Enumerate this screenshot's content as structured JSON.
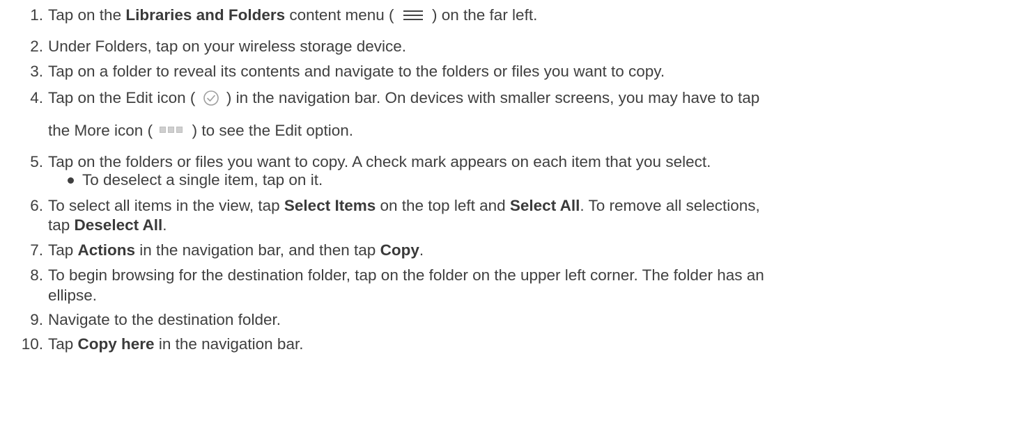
{
  "steps": [
    {
      "number": "1.",
      "parts": [
        "Tap on the ",
        "Libraries and Folders",
        " content menu ( ",
        " ) on the far left."
      ],
      "icon": "hamburger-menu-icon"
    },
    {
      "number": "2.",
      "text": "Under Folders, tap on your wireless storage device."
    },
    {
      "number": "3.",
      "text": "Tap on a folder to reveal its contents and navigate to the folders or files you want to copy."
    },
    {
      "number": "4.",
      "line1_parts": [
        "Tap on the Edit icon ( ",
        " ) in the navigation bar. On devices with smaller screens, you may have to tap"
      ],
      "line2_parts": [
        "the More icon ( ",
        " ) to see the Edit option."
      ],
      "icons": [
        "edit-checkmark-icon",
        "more-dots-icon"
      ]
    },
    {
      "number": "5.",
      "text": "Tap on the folders or files you want to copy. A check mark appears on each item that you select.",
      "bullet": "To deselect a single item, tap on it."
    },
    {
      "number": "6.",
      "line1_parts": [
        "To select all items in the view, tap ",
        "Select Items",
        " on the top left and ",
        "Select All",
        ". To remove all selections,"
      ],
      "line2_parts": [
        "tap ",
        "Deselect All",
        "."
      ]
    },
    {
      "number": "7.",
      "parts": [
        "Tap ",
        "Actions",
        " in the navigation bar, and then tap ",
        "Copy",
        "."
      ]
    },
    {
      "number": "8.",
      "line1": "To begin browsing for the destination folder, tap on the folder on the upper left corner. The folder has an",
      "line2": "ellipse."
    },
    {
      "number": "9.",
      "text": "Navigate to the destination folder."
    },
    {
      "number": "10.",
      "parts": [
        "Tap ",
        "Copy here",
        " in the navigation bar."
      ]
    }
  ],
  "colors": {
    "text": "#3f3f3f",
    "icon_gray": "#9e9e9e"
  }
}
